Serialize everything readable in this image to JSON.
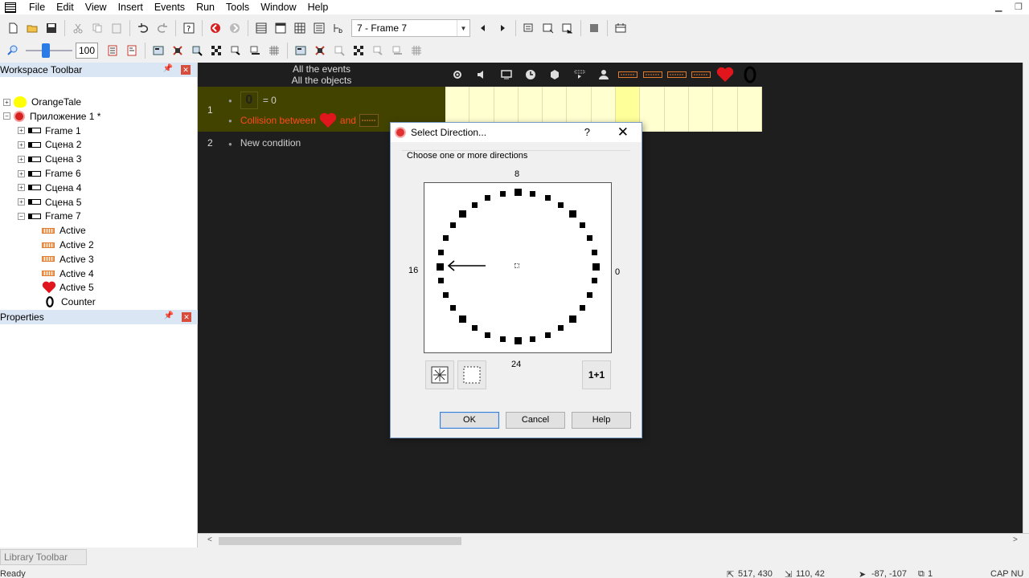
{
  "menu": [
    "File",
    "Edit",
    "View",
    "Insert",
    "Events",
    "Run",
    "Tools",
    "Window",
    "Help"
  ],
  "toolbar": {
    "frame_combo": "7 - Frame 7",
    "zoom_value": "100"
  },
  "workspace": {
    "title": "Workspace Toolbar",
    "items": [
      {
        "label": "OrangeTale",
        "kind": "app-yellow",
        "exp": "+",
        "depth": 0
      },
      {
        "label": "Приложение 1 *",
        "kind": "app-red",
        "exp": "−",
        "depth": 0
      },
      {
        "label": "Frame 1",
        "kind": "frame",
        "exp": "+",
        "depth": 1
      },
      {
        "label": "Сцена 2",
        "kind": "frame",
        "exp": "+",
        "depth": 1
      },
      {
        "label": "Сцена 3",
        "kind": "frame",
        "exp": "+",
        "depth": 1
      },
      {
        "label": "Frame 6",
        "kind": "frame",
        "exp": "+",
        "depth": 1
      },
      {
        "label": "Сцена 4",
        "kind": "frame",
        "exp": "+",
        "depth": 1
      },
      {
        "label": "Сцена 5",
        "kind": "frame",
        "exp": "+",
        "depth": 1
      },
      {
        "label": "Frame 7",
        "kind": "frame",
        "exp": "−",
        "depth": 1
      },
      {
        "label": "Active",
        "kind": "active",
        "exp": "",
        "depth": 2
      },
      {
        "label": "Active 2",
        "kind": "active",
        "exp": "",
        "depth": 2
      },
      {
        "label": "Active 3",
        "kind": "active",
        "exp": "",
        "depth": 2
      },
      {
        "label": "Active 4",
        "kind": "active",
        "exp": "",
        "depth": 2
      },
      {
        "label": "Active 5",
        "kind": "heart",
        "exp": "",
        "depth": 2
      },
      {
        "label": "Counter",
        "kind": "counter",
        "exp": "",
        "depth": 2
      }
    ]
  },
  "properties": {
    "title": "Properties"
  },
  "events": {
    "header_line1": "All the events",
    "header_line2": "All the objects",
    "row1_number": "1",
    "row1_cond1_value": "= 0",
    "row1_cond1_counter": "0",
    "row1_cond2_text": "Collision between",
    "row1_cond2_and": "and",
    "row2_number": "2",
    "row2_text": "New condition"
  },
  "library": {
    "title": "Library Toolbar"
  },
  "status": {
    "left": "Ready",
    "coord1": "517, 430",
    "coord2": "110, 42",
    "coord3": "-87, -107",
    "layer": "1",
    "keys": "CAP  NU"
  },
  "dialog": {
    "title": "Select Direction...",
    "help_glyph": "?",
    "close_glyph": "✕",
    "prompt": "Choose one or more directions",
    "label_top": "8",
    "label_left": "16",
    "label_right": "0",
    "label_bottom": "24",
    "plus_button": "1+1",
    "ok": "OK",
    "cancel": "Cancel",
    "help": "Help",
    "selected_direction": 16
  },
  "colors": {
    "editor_bg": "#1e1e1e",
    "row_highlight": "#434300",
    "grid_cell": "#ffffd0",
    "condition_red": "#ff4a1c"
  }
}
